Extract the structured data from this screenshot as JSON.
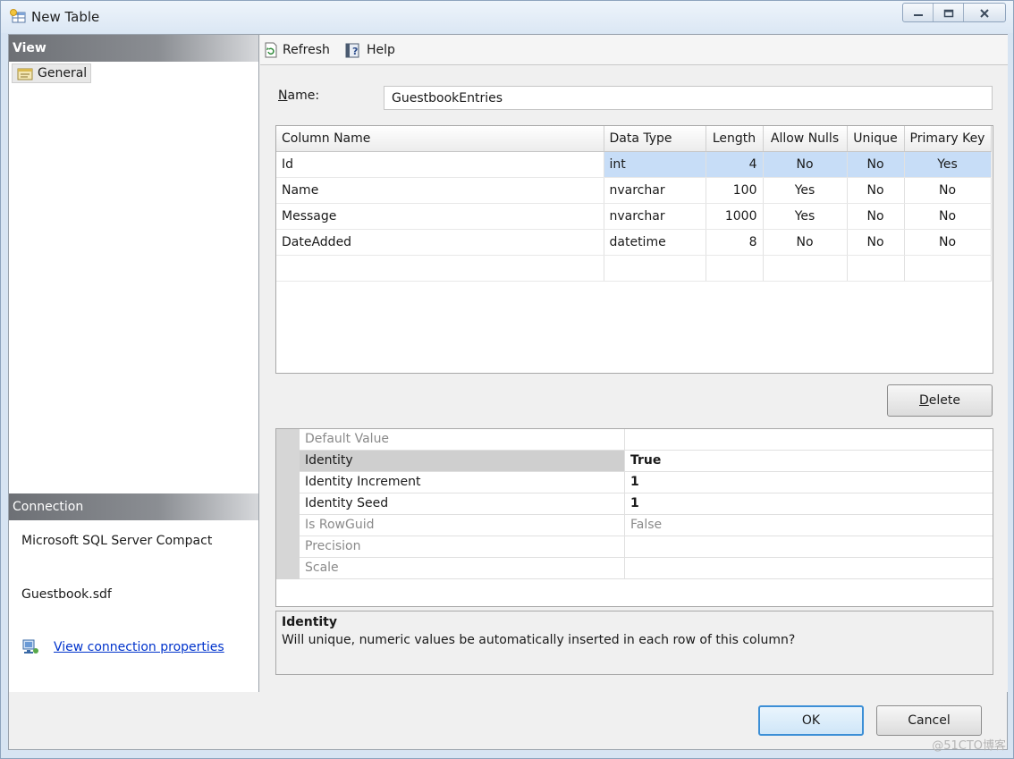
{
  "window": {
    "title": "New Table",
    "icon": "table-icon"
  },
  "left_panel": {
    "view_header": "View",
    "general_item": "General",
    "connection_header": "Connection",
    "connection_provider": "Microsoft SQL Server Compact",
    "connection_file": "Guestbook.sdf",
    "connection_link": "View connection properties"
  },
  "toolbar": {
    "refresh": "Refresh",
    "help": "Help"
  },
  "name_field": {
    "label_accel": "N",
    "label_rest": "ame:",
    "value": "GuestbookEntries"
  },
  "columns_grid": {
    "headers": [
      "Column Name",
      "Data Type",
      "Length",
      "Allow Nulls",
      "Unique",
      "Primary Key"
    ],
    "rows": [
      [
        "Id",
        "int",
        "4",
        "No",
        "No",
        "Yes"
      ],
      [
        "Name",
        "nvarchar",
        "100",
        "Yes",
        "No",
        "No"
      ],
      [
        "Message",
        "nvarchar",
        "1000",
        "Yes",
        "No",
        "No"
      ],
      [
        "DateAdded",
        "datetime",
        "8",
        "No",
        "No",
        "No"
      ]
    ],
    "selected_row": 0
  },
  "delete_button": {
    "accel": "D",
    "rest": "elete"
  },
  "properties": [
    {
      "name": "Default Value",
      "value": ""
    },
    {
      "name": "Identity",
      "value": "True"
    },
    {
      "name": "Identity Increment",
      "value": "1"
    },
    {
      "name": "Identity Seed",
      "value": "1"
    },
    {
      "name": "Is RowGuid",
      "value": "False"
    },
    {
      "name": "Precision",
      "value": ""
    },
    {
      "name": "Scale",
      "value": ""
    }
  ],
  "description": {
    "title": "Identity",
    "text": "Will unique, numeric values be automatically inserted in each row of this column?"
  },
  "footer": {
    "ok": "OK",
    "cancel": "Cancel",
    "watermark": "@51CTO博客"
  }
}
